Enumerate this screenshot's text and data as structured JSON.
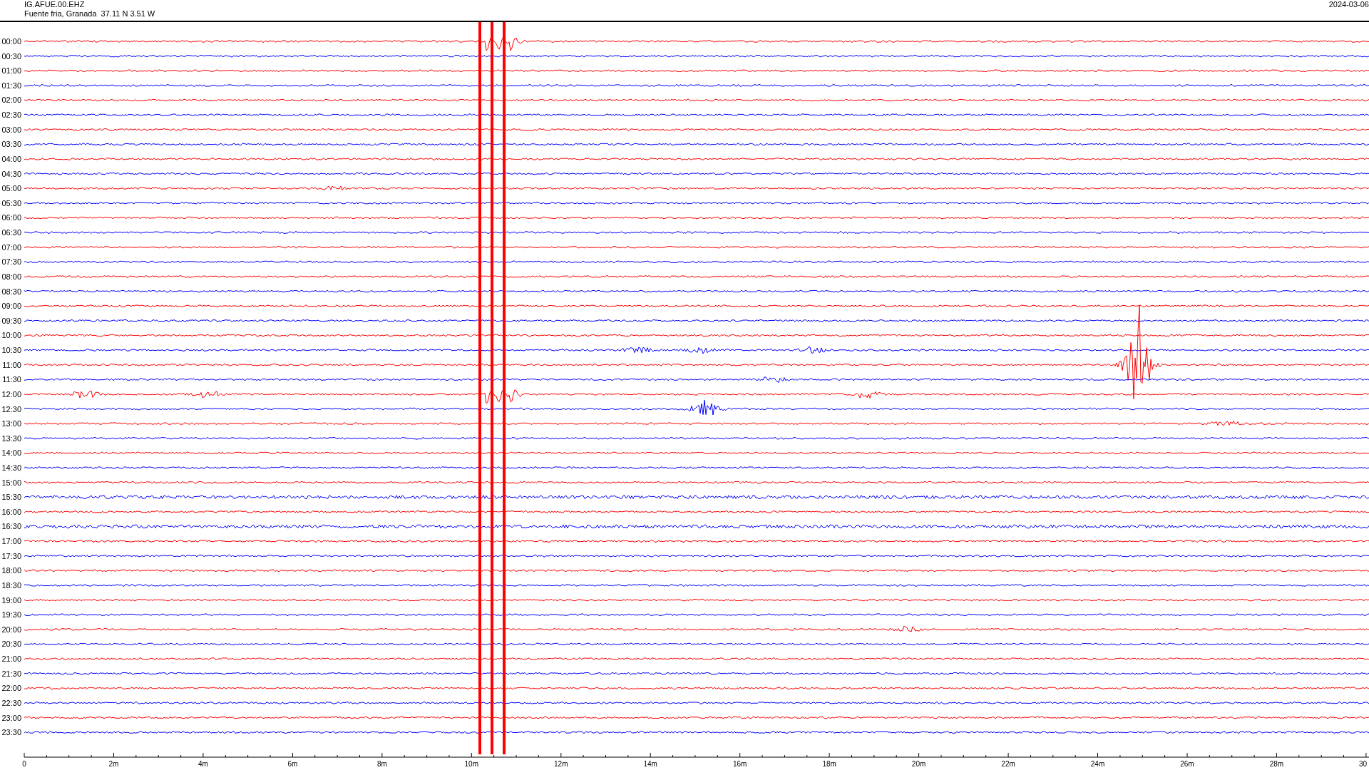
{
  "header": {
    "station": "IG.AFUE.00.EHZ",
    "location": "Fuente fria, Granada  37.11 N 3.51 W",
    "date": "2024-03-06"
  },
  "rows": [
    {
      "label": "00:00",
      "color": "#ff0000"
    },
    {
      "label": "00:30",
      "color": "#0000ff"
    },
    {
      "label": "01:00",
      "color": "#ff0000"
    },
    {
      "label": "01:30",
      "color": "#0000ff"
    },
    {
      "label": "02:00",
      "color": "#ff0000"
    },
    {
      "label": "02:30",
      "color": "#0000ff"
    },
    {
      "label": "03:00",
      "color": "#ff0000"
    },
    {
      "label": "03:30",
      "color": "#0000ff"
    },
    {
      "label": "04:00",
      "color": "#ff0000"
    },
    {
      "label": "04:30",
      "color": "#0000ff"
    },
    {
      "label": "05:00",
      "color": "#ff0000"
    },
    {
      "label": "05:30",
      "color": "#0000ff"
    },
    {
      "label": "06:00",
      "color": "#ff0000"
    },
    {
      "label": "06:30",
      "color": "#0000ff"
    },
    {
      "label": "07:00",
      "color": "#ff0000"
    },
    {
      "label": "07:30",
      "color": "#0000ff"
    },
    {
      "label": "08:00",
      "color": "#ff0000"
    },
    {
      "label": "08:30",
      "color": "#0000ff"
    },
    {
      "label": "09:00",
      "color": "#ff0000"
    },
    {
      "label": "09:30",
      "color": "#0000ff"
    },
    {
      "label": "10:00",
      "color": "#ff0000"
    },
    {
      "label": "10:30",
      "color": "#0000ff"
    },
    {
      "label": "11:00",
      "color": "#ff0000"
    },
    {
      "label": "11:30",
      "color": "#0000ff"
    },
    {
      "label": "12:00",
      "color": "#ff0000"
    },
    {
      "label": "12:30",
      "color": "#0000ff"
    },
    {
      "label": "13:00",
      "color": "#ff0000"
    },
    {
      "label": "13:30",
      "color": "#0000ff"
    },
    {
      "label": "14:00",
      "color": "#ff0000"
    },
    {
      "label": "14:30",
      "color": "#0000ff"
    },
    {
      "label": "15:00",
      "color": "#ff0000"
    },
    {
      "label": "15:30",
      "color": "#0000ff"
    },
    {
      "label": "16:00",
      "color": "#ff0000"
    },
    {
      "label": "16:30",
      "color": "#0000ff"
    },
    {
      "label": "17:00",
      "color": "#ff0000"
    },
    {
      "label": "17:30",
      "color": "#0000ff"
    },
    {
      "label": "18:00",
      "color": "#ff0000"
    },
    {
      "label": "18:30",
      "color": "#0000ff"
    },
    {
      "label": "19:00",
      "color": "#ff0000"
    },
    {
      "label": "19:30",
      "color": "#0000ff"
    },
    {
      "label": "20:00",
      "color": "#ff0000"
    },
    {
      "label": "20:30",
      "color": "#0000ff"
    },
    {
      "label": "21:00",
      "color": "#ff0000"
    },
    {
      "label": "21:30",
      "color": "#0000ff"
    },
    {
      "label": "22:00",
      "color": "#ff0000"
    },
    {
      "label": "22:30",
      "color": "#0000ff"
    },
    {
      "label": "23:00",
      "color": "#ff0000"
    },
    {
      "label": "23:30",
      "color": "#0000ff"
    }
  ],
  "x_axis": {
    "labels": [
      "0",
      "2m",
      "4m",
      "6m",
      "8m",
      "10m",
      "12m",
      "14m",
      "16m",
      "18m",
      "20m",
      "22m",
      "24m",
      "26m",
      "28m",
      "30"
    ]
  }
}
